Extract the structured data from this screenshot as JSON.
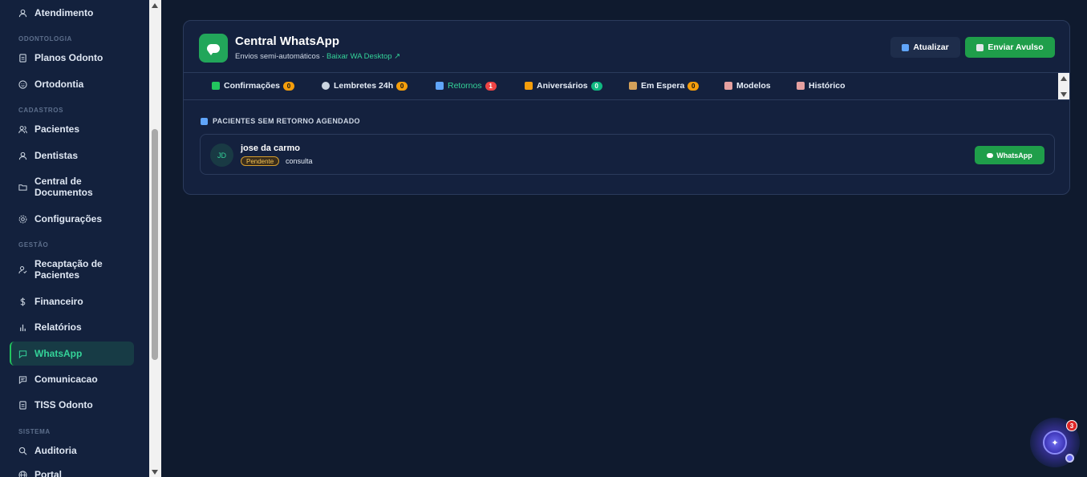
{
  "sidebar": {
    "items": [
      {
        "label": "Atendimento",
        "icon": "user-icon"
      },
      {
        "label": "Planos Odonto",
        "icon": "file-icon"
      },
      {
        "label": "Ortodontia",
        "icon": "smile-icon"
      },
      {
        "label": "Pacientes",
        "icon": "users-icon"
      },
      {
        "label": "Dentistas",
        "icon": "user-icon"
      },
      {
        "label": "Central de Documentos",
        "icon": "folder-icon"
      },
      {
        "label": "Configurações",
        "icon": "gear-icon"
      },
      {
        "label": "Recaptação de Pacientes",
        "icon": "user-check-icon"
      },
      {
        "label": "Financeiro",
        "icon": "dollar-icon"
      },
      {
        "label": "Relatórios",
        "icon": "bar-chart-icon"
      },
      {
        "label": "WhatsApp",
        "icon": "message-icon"
      },
      {
        "label": "Comunicacao",
        "icon": "chat-icon"
      },
      {
        "label": "TISS Odonto",
        "icon": "file-icon"
      },
      {
        "label": "Auditoria",
        "icon": "search-icon"
      },
      {
        "label": "Portal",
        "icon": "globe-icon"
      }
    ],
    "sections": [
      "ODONTOLOGIA",
      "CADASTROS",
      "GESTÃO",
      "SISTEMA"
    ],
    "active": "WhatsApp"
  },
  "header": {
    "title": "Central WhatsApp",
    "subtitle": "Envios semi-automáticos · ",
    "link": "Baixar WA Desktop ↗",
    "refresh_label": "Atualizar",
    "send_label": "Enviar Avulso"
  },
  "tabs": [
    {
      "label": "Confirmações",
      "badge": "0",
      "badge_color": "#f59e0b",
      "icon_color": "#22c55e"
    },
    {
      "label": "Lembretes 24h",
      "badge": "0",
      "badge_color": "#f59e0b",
      "icon_color": "#cbd5e1"
    },
    {
      "label": "Retornos",
      "badge": "1",
      "badge_color": "#ef4444",
      "icon_color": "#60a5fa"
    },
    {
      "label": "Aniversários",
      "badge": "0",
      "badge_color": "#10b981",
      "icon_color": "#f59e0b"
    },
    {
      "label": "Em Espera",
      "badge": "0",
      "badge_color": "#f59e0b",
      "icon_color": "#d4a15a"
    },
    {
      "label": "Modelos",
      "badge": "",
      "badge_color": "",
      "icon_color": "#e5a0a0"
    },
    {
      "label": "Histórico",
      "badge": "",
      "badge_color": "",
      "icon_color": "#e5a0a0"
    }
  ],
  "section_title": "PACIENTES SEM RETORNO AGENDADO",
  "patient": {
    "initials": "JD",
    "name": "jose da carmo",
    "status": "Pendente",
    "type": "consulta",
    "action_label": "WhatsApp"
  },
  "assistant": {
    "badge": "3"
  }
}
